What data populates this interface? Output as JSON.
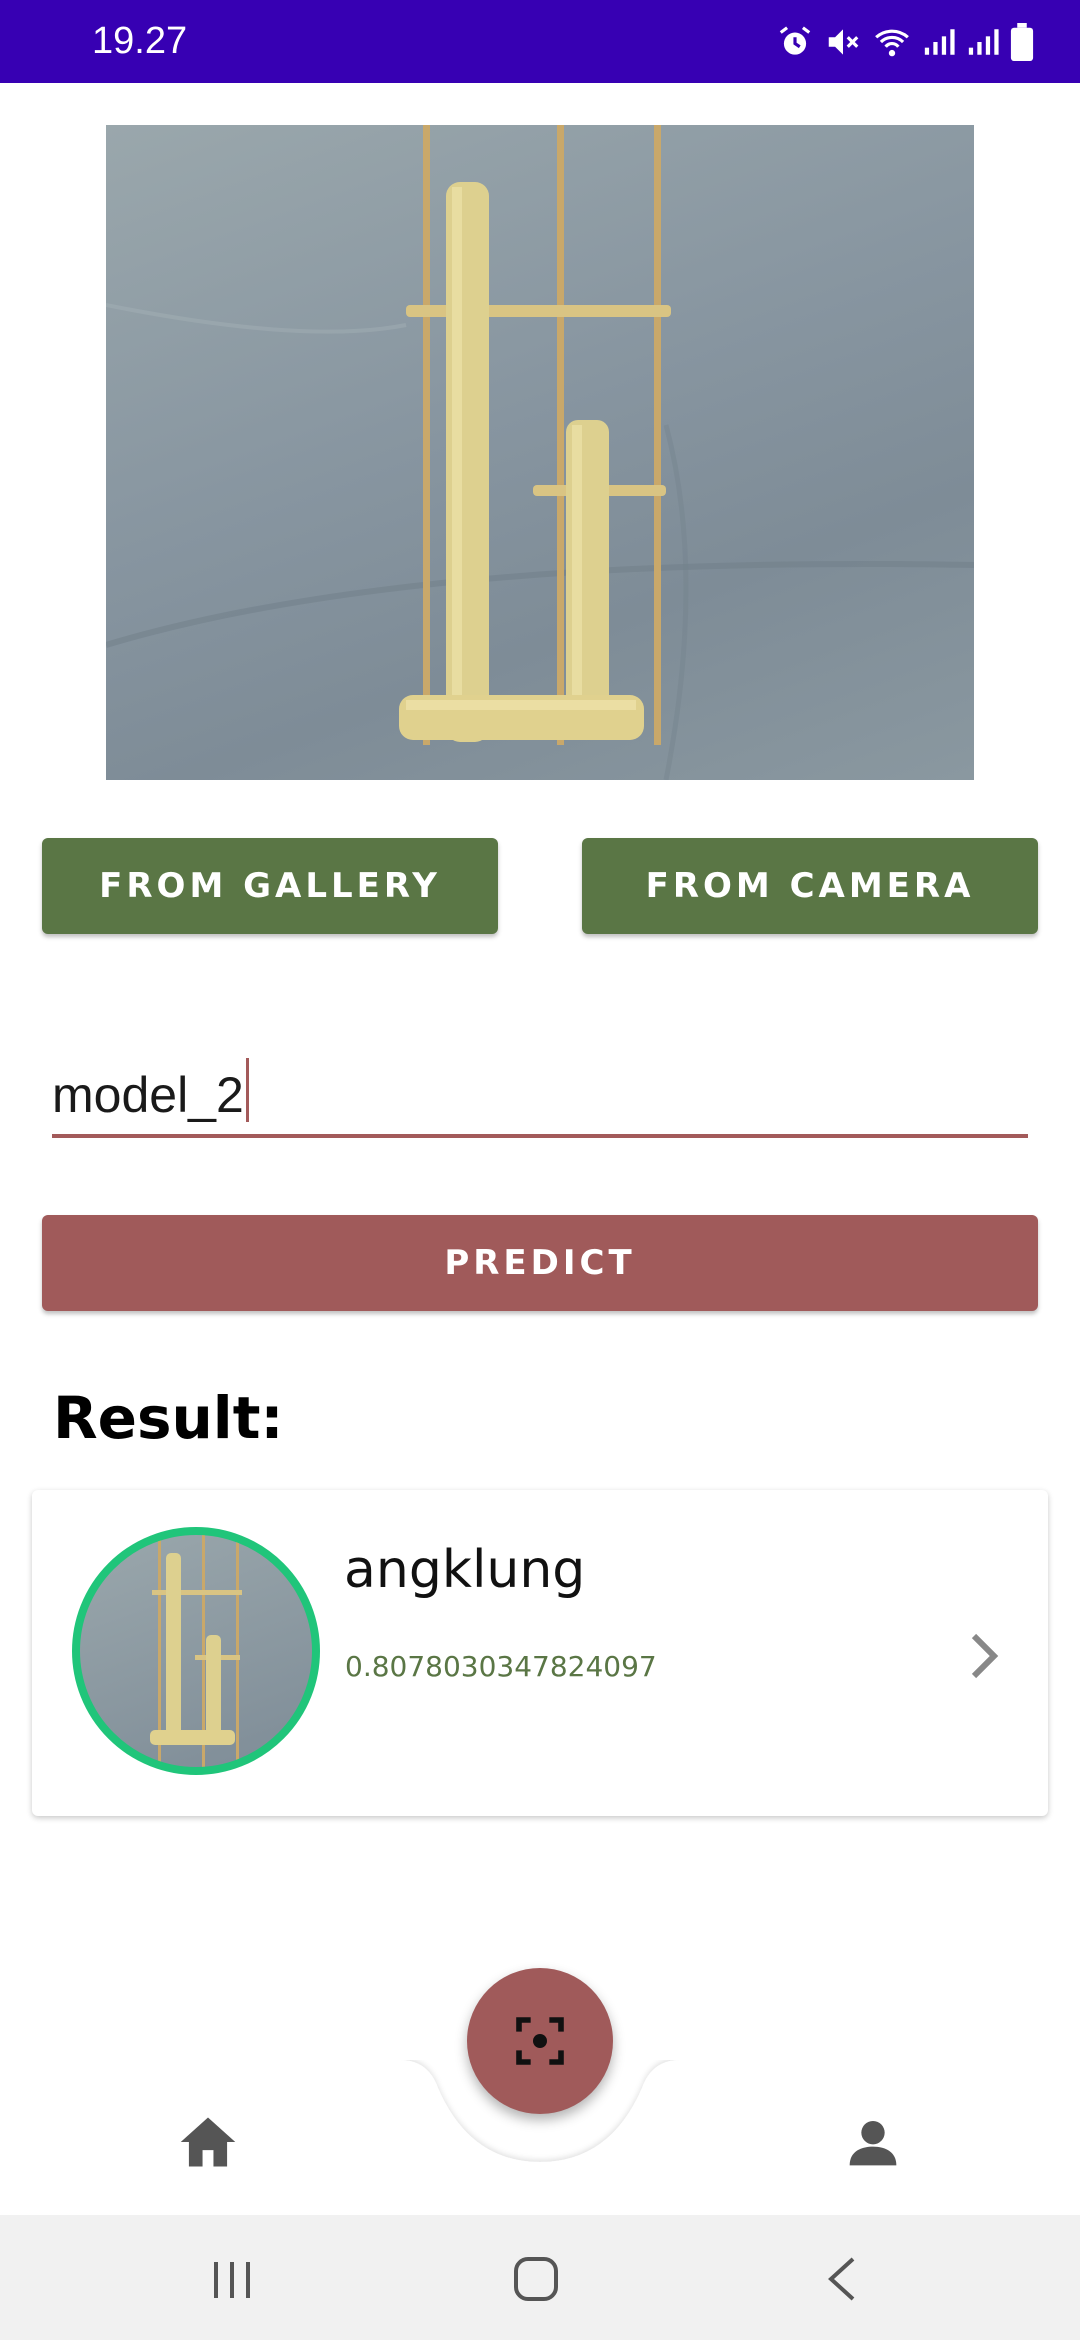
{
  "status_bar": {
    "time": "19.27",
    "icons": [
      "alarm-icon",
      "mute-icon",
      "wifi-icon",
      "signal-icon",
      "signal-icon",
      "battery-icon"
    ]
  },
  "image_preview": {
    "subject": "angklung-photo"
  },
  "buttons": {
    "gallery_label": "FROM GALLERY",
    "camera_label": "FROM CAMERA",
    "predict_label": "PREDICT"
  },
  "model_field": {
    "value": "model_2"
  },
  "result": {
    "heading": "Result:",
    "items": [
      {
        "label": "angklung",
        "score": "0.8078030347824097"
      }
    ]
  },
  "bottom_nav": {
    "items": [
      "home-icon",
      "scan-icon",
      "profile-icon"
    ]
  },
  "system_nav": [
    "recents-icon",
    "home-circle-icon",
    "back-icon"
  ],
  "colors": {
    "status_bar": "#3700b3",
    "green_button": "#5a7645",
    "red_button": "#a05a5a",
    "accent_ring": "#20c57a"
  }
}
